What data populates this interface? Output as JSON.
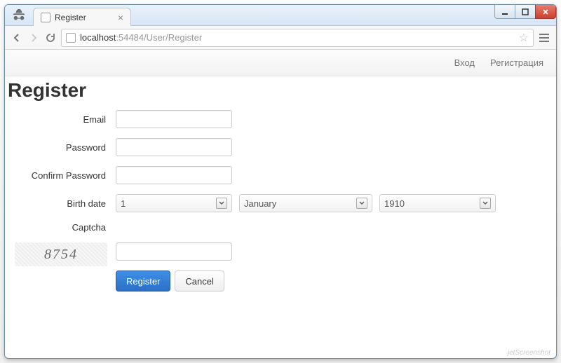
{
  "window": {
    "tab_title": "Register"
  },
  "omnibox": {
    "host": "localhost",
    "rest": ":54484/User/Register"
  },
  "navbar": {
    "login": "Вход",
    "register": "Регистрация"
  },
  "page": {
    "heading": "Register"
  },
  "form": {
    "email_label": "Email",
    "email_value": "",
    "password_label": "Password",
    "password_value": "",
    "confirm_label": "Confirm Password",
    "confirm_value": "",
    "birth_label": "Birth date",
    "birth_day": "1",
    "birth_month": "January",
    "birth_year": "1910",
    "captcha_label": "Captcha",
    "captcha_text": "8754",
    "captcha_value": "",
    "submit_label": "Register",
    "cancel_label": "Cancel"
  },
  "watermark": "jetScreenshot"
}
